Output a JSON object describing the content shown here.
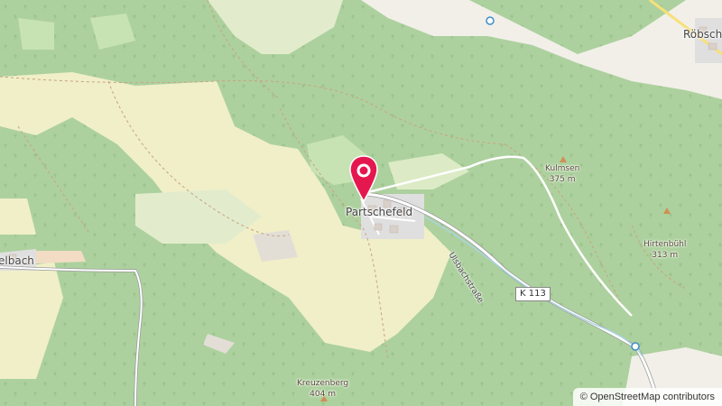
{
  "map": {
    "places": {
      "partschefeld": "Partschefeld",
      "robschuetz": "Röbsch",
      "elbach": "elbach"
    },
    "peaks": [
      {
        "name": "Kulmsen",
        "elevation": "375 m"
      },
      {
        "name": "Hirtenbühl",
        "elevation": "313 m"
      },
      {
        "name": "Kreuzenberg",
        "elevation": "404 m"
      }
    ],
    "street": "Ulsbachstraße",
    "road_ref": "K 113",
    "attribution": {
      "symbol": "©",
      "text": "OpenStreetMap contributors"
    },
    "marker_icon": "location-pin-icon"
  }
}
